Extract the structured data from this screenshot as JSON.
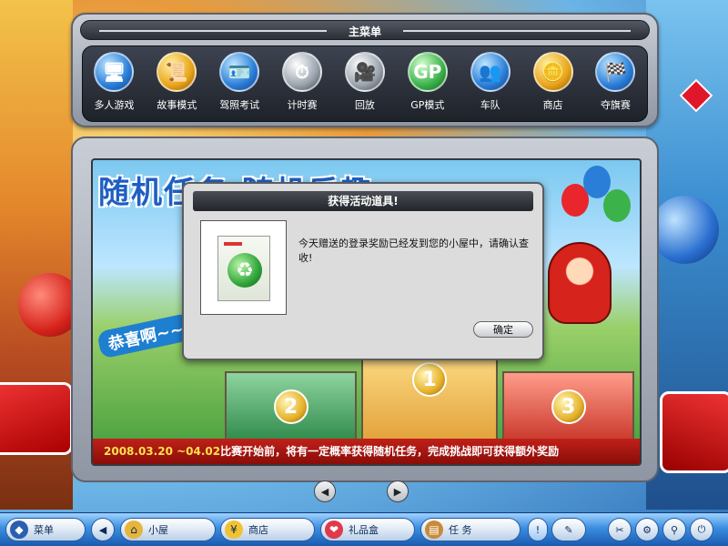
{
  "top_menu": {
    "title": "主菜单",
    "items": [
      {
        "label": "多人游戏",
        "icon": "globe-monitor-icon"
      },
      {
        "label": "故事模式",
        "icon": "scroll-icon"
      },
      {
        "label": "驾照考试",
        "icon": "license-card-icon"
      },
      {
        "label": "计时赛",
        "icon": "stopwatch-icon"
      },
      {
        "label": "回放",
        "icon": "camera-replay-icon"
      },
      {
        "label": "GP模式",
        "icon": "gp-badge-icon",
        "text": "GP"
      },
      {
        "label": "车队",
        "icon": "team-icon"
      },
      {
        "label": "商店",
        "icon": "gold-coin-icon"
      },
      {
        "label": "夺旗赛",
        "icon": "flag-icon"
      }
    ]
  },
  "banner": {
    "title": "随机任务 随机乐趣",
    "subtitle": "恭喜啊~~",
    "podium": [
      "1",
      "2",
      "3"
    ],
    "footer_date": "2008.03.20 ~04.02",
    "footer_text": "比赛开始前，将有一定概率获得随机任务，完成挑战即可获得额外奖励"
  },
  "dialog": {
    "title": "获得活动道具!",
    "message": "今天赠送的登录奖励已经发到您的小屋中，请确认查收!",
    "confirm_label": "确定",
    "item_icon": "recycle-icon"
  },
  "pager": {
    "prev": "◀",
    "next": "▶"
  },
  "taskbar": {
    "menu_label": "菜单",
    "house_label": "小屋",
    "shop_label": "商店",
    "gift_label": "礼品盒",
    "task_label": "任  务",
    "alert": "!"
  }
}
